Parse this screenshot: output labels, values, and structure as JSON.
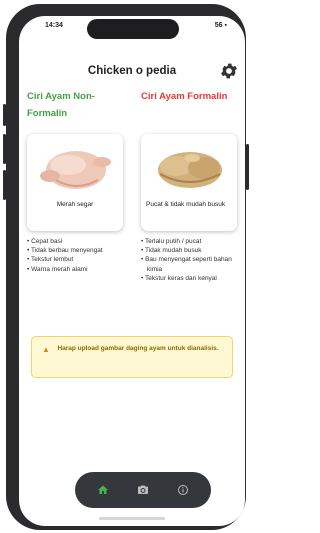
{
  "status_bar": {
    "time": "14:34",
    "indicators": "▪ ▪",
    "right": "56 ▪"
  },
  "header": {
    "title": "Chicken o pedia",
    "settings_icon": "gear-icon"
  },
  "non_formalin": {
    "heading": "Ciri Ayam Non-Formalin",
    "heading_color": "#43a047",
    "card_caption": "Merah segar",
    "traits": [
      "Cepat basi",
      "Tidak berbau menyengat",
      "Tekstur lembut",
      "Warna merah alami"
    ]
  },
  "formalin": {
    "heading": "Ciri Ayam Formalin",
    "heading_color": "#e53935",
    "card_caption": "Pucat & tidak mudah busuk",
    "traits": [
      "Terlalu putih / pucat",
      "Tidak mudah busuk",
      "Bau menyengat seperti bahan kimia",
      "Tekstur keras dan kenyal"
    ]
  },
  "warning": {
    "icon": "warning-icon",
    "text": "Harap upload gambar daging ayam untuk dianalisis."
  },
  "nav": [
    {
      "icon": "home-icon",
      "active": true
    },
    {
      "icon": "camera-icon",
      "active": false
    },
    {
      "icon": "info-icon",
      "active": false
    }
  ],
  "colors": {
    "accent_green": "#43a047",
    "accent_red": "#e53935",
    "navbar": "#34383c",
    "warning_bg": "#fff8d2"
  }
}
